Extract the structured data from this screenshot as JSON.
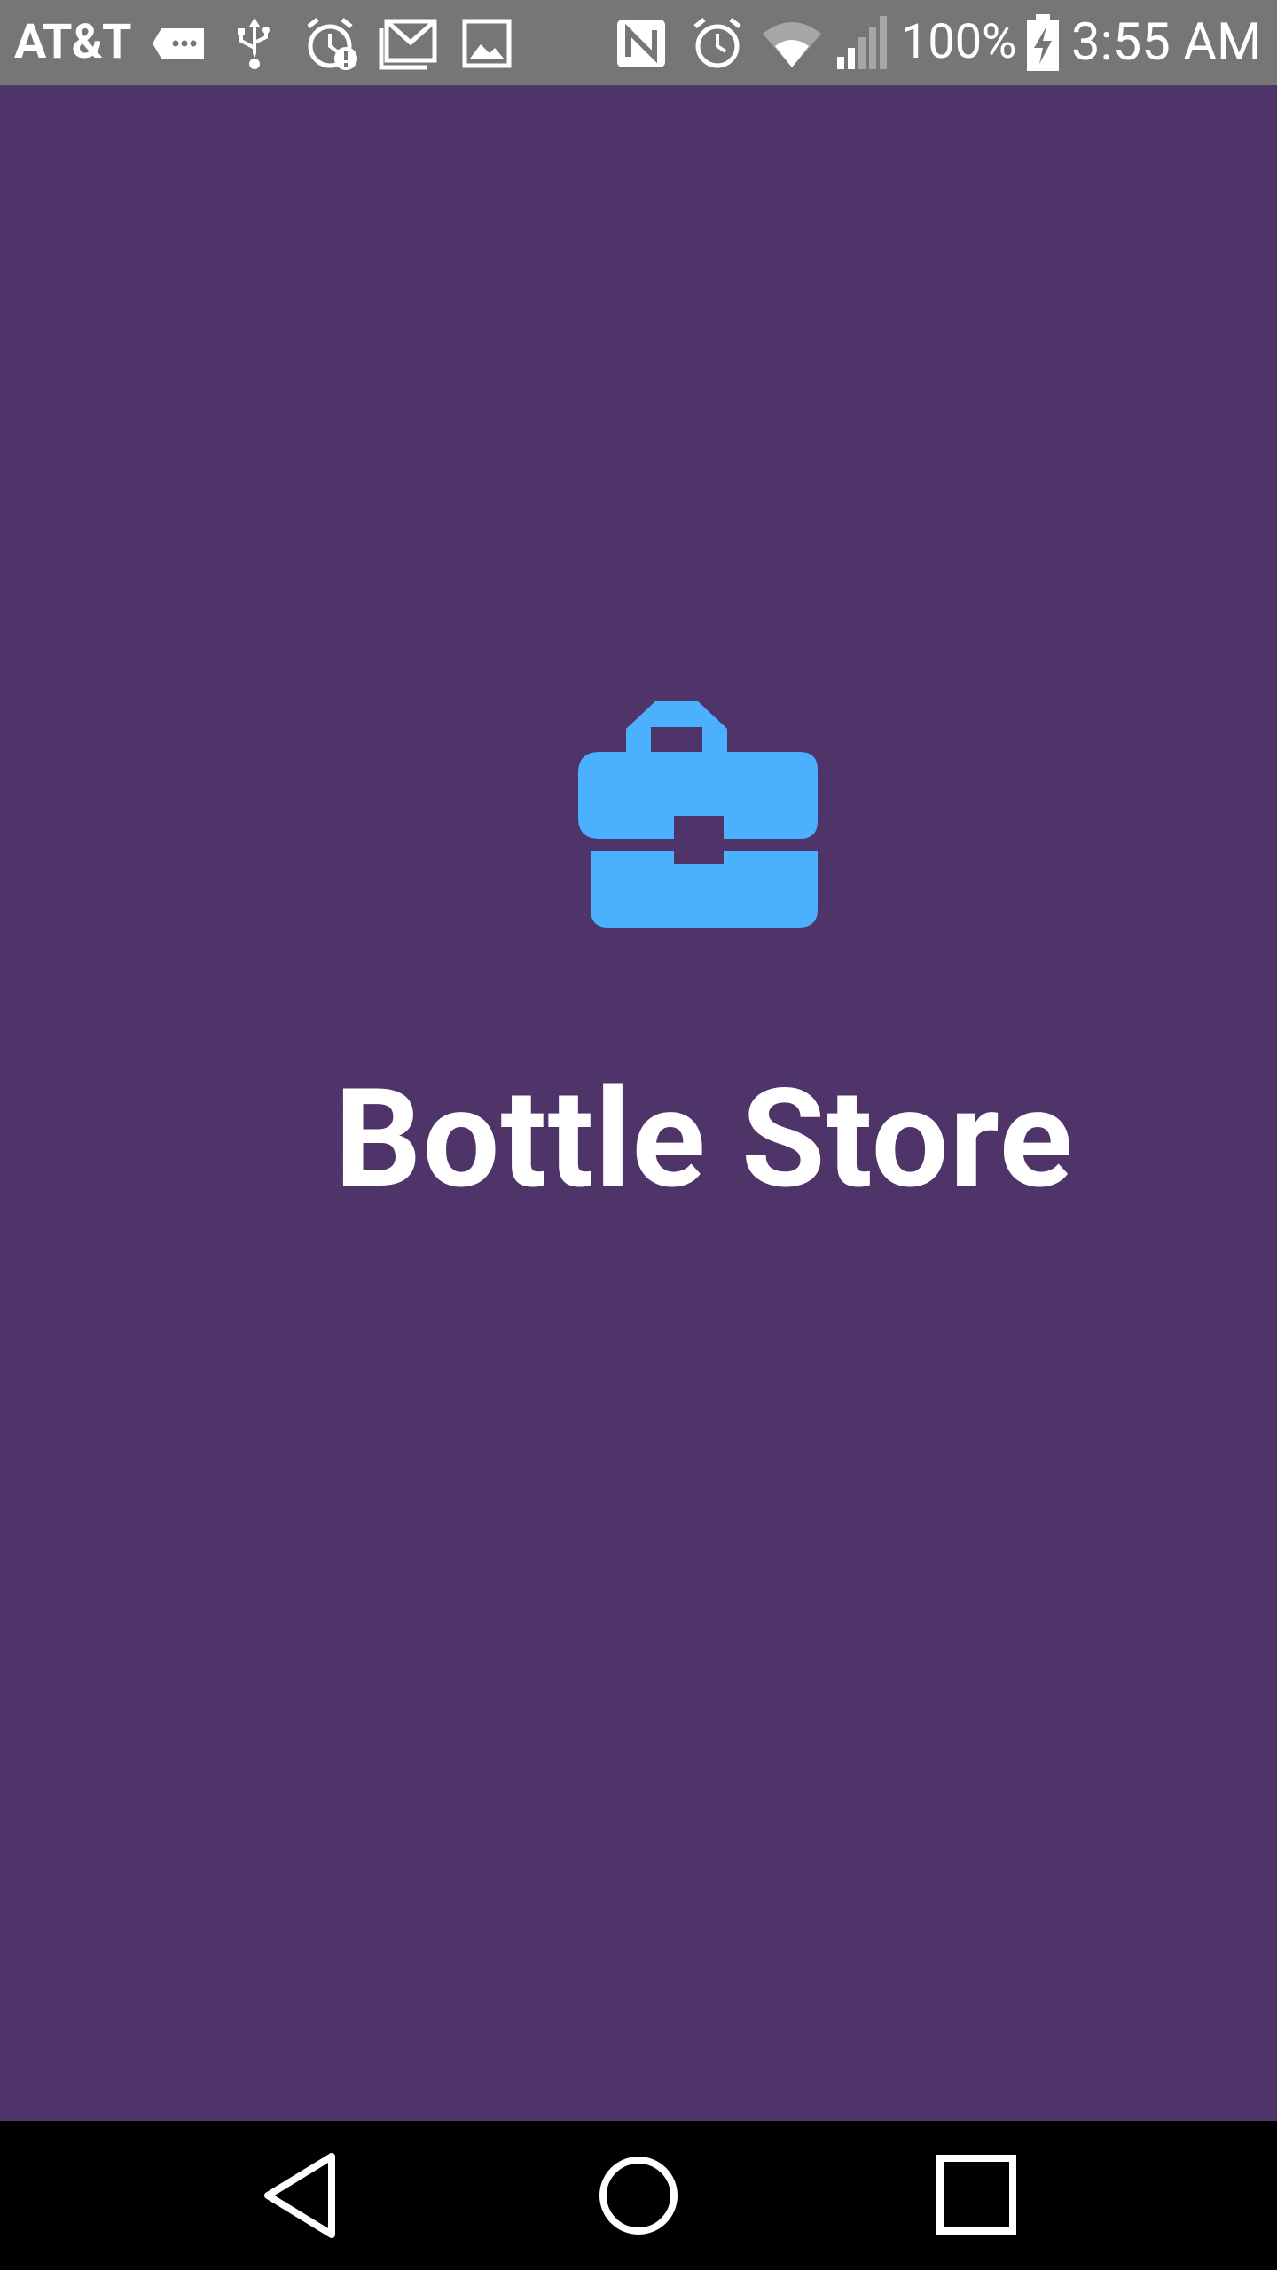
{
  "status_bar": {
    "carrier": "AT&T",
    "battery_percent": "100%",
    "time": "3:55 AM",
    "icons": [
      "messages-icon",
      "usb-icon",
      "alarm-alert-icon",
      "gmail-icon",
      "gallery-icon",
      "nfc-icon",
      "alarm-icon",
      "wifi-icon",
      "cell-signal-icon",
      "battery-charging-icon"
    ]
  },
  "app": {
    "title": "Bottle Store",
    "logo_icon": "briefcase-icon"
  },
  "colors": {
    "background": "#4e3469",
    "logo": "#4bb1ff",
    "status_bar": "#767676",
    "nav_bar": "#000000",
    "text": "#ffffff"
  },
  "nav_bar": {
    "buttons": [
      "back-button",
      "home-button",
      "recents-button"
    ]
  }
}
